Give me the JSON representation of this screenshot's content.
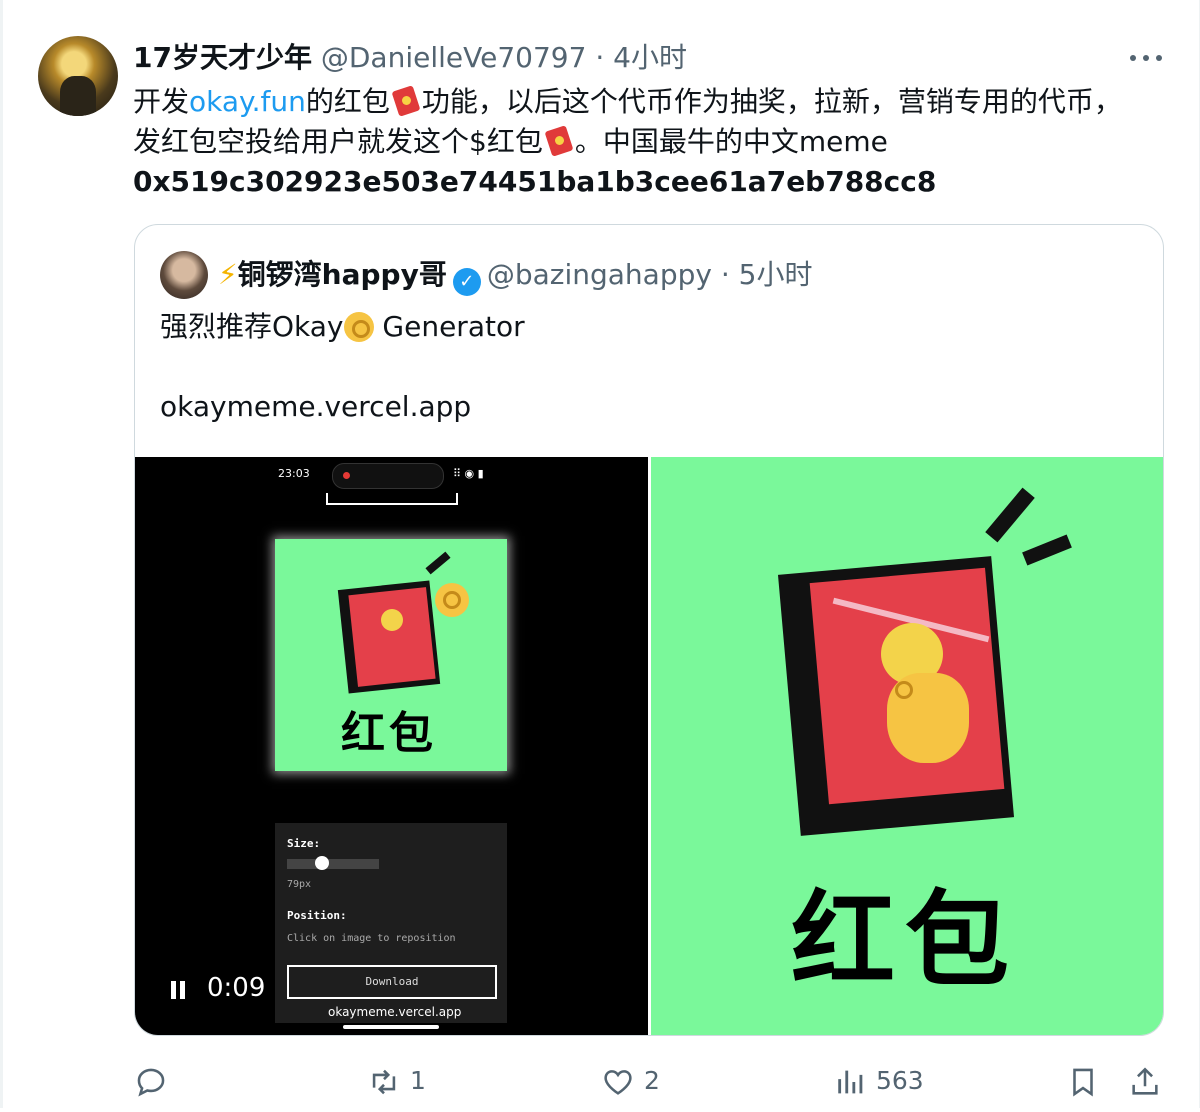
{
  "tweet": {
    "display_name": "17岁天才少年",
    "handle": "@DanielleVe70797",
    "time": "4小时",
    "text_part1": "开发",
    "link_text": "okay.fun",
    "text_part2": "的红包",
    "text_part3": "功能，以后这个代币作为抽奖，拉新，营销专用的代币，发红包空投给用户就发这个$红包",
    "text_part4": "。中国最牛的中文meme",
    "contract_address": "0x519c302923e503e74451ba1b3cee61a7eb788cc8"
  },
  "quoted": {
    "display_name": "铜锣湾happy哥",
    "handle": "@bazingahappy",
    "time": "5小时",
    "text_line1a": "强烈推荐Okay",
    "text_line1b": "Generator",
    "text_line2": "okaymeme.vercel.app"
  },
  "video": {
    "status_time": "23:03",
    "card_text": "红包",
    "size_label": "Size:",
    "size_value": "79px",
    "position_label": "Position:",
    "position_hint": "Click on image to reposition",
    "download_label": "Download",
    "url_bar": "okaymeme.vercel.app",
    "elapsed": "0:09",
    "slider_level": 0.3
  },
  "image": {
    "caption_text": "红包"
  },
  "actions": {
    "reply_count": "",
    "retweet_count": "1",
    "like_count": "2",
    "views_count": "563"
  },
  "colors": {
    "link": "#1d9bf0",
    "meme_green": "#7af89a",
    "envelope_red": "#e4404a",
    "coin_yellow": "#f3d34a"
  },
  "icons": [
    "more-icon",
    "verified-icon",
    "lightning-icon",
    "red-envelope-icon",
    "ok-hand-icon",
    "pause-icon",
    "reply-icon",
    "retweet-icon",
    "like-icon",
    "views-icon",
    "bookmark-icon",
    "share-icon"
  ]
}
